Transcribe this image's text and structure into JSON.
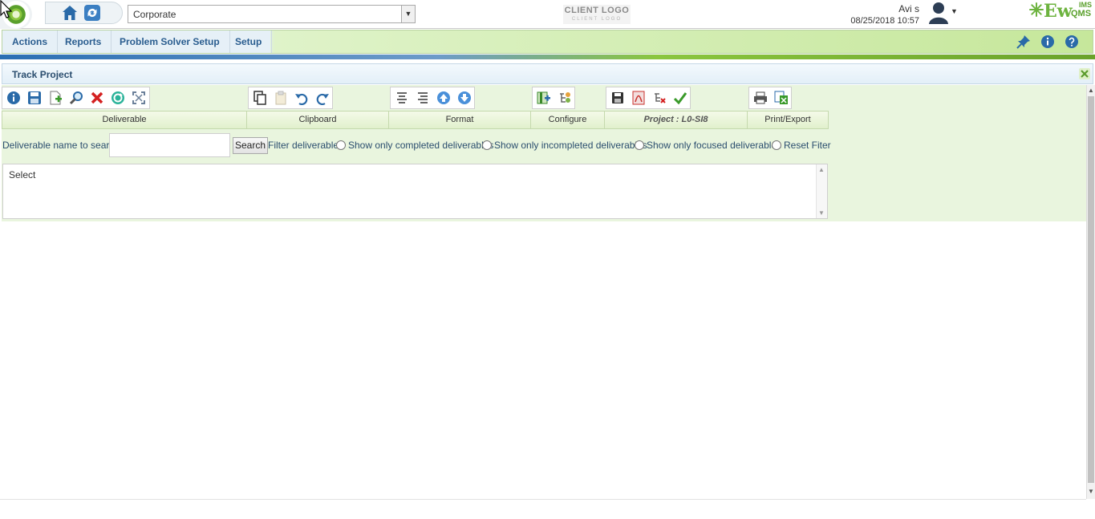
{
  "header": {
    "org_selector_value": "Corporate",
    "client_logo_text": "CLIENT LOGO",
    "client_logo_subtext": "CLIENT LOGO",
    "user_name": "Avi s",
    "datetime": "08/25/2018 10:57",
    "brand_main": "Ew",
    "brand_qms": "QMS",
    "brand_ims": "IMS"
  },
  "menu": {
    "items": [
      "Actions",
      "Reports",
      "Problem Solver Setup",
      "Setup"
    ]
  },
  "panel": {
    "title": "Track Project"
  },
  "ribbon": {
    "groups": [
      "Deliverable",
      "Clipboard",
      "Format",
      "Configure",
      "Project : L0-SI8",
      "Print/Export"
    ]
  },
  "search": {
    "label": "Deliverable name to search",
    "input_value": "",
    "button_label": "Search",
    "filter_label": "Filter deliverable",
    "options": [
      "Show only completed deliverables",
      "Show only incompleted deliverables",
      "Show only focused deliverables",
      "Reset Fiter"
    ]
  },
  "list": {
    "placeholder_item": "Select"
  },
  "colors": {
    "accent_blue": "#2a5d8f",
    "accent_green": "#8cc63f",
    "panel_green": "#e9f5de"
  }
}
